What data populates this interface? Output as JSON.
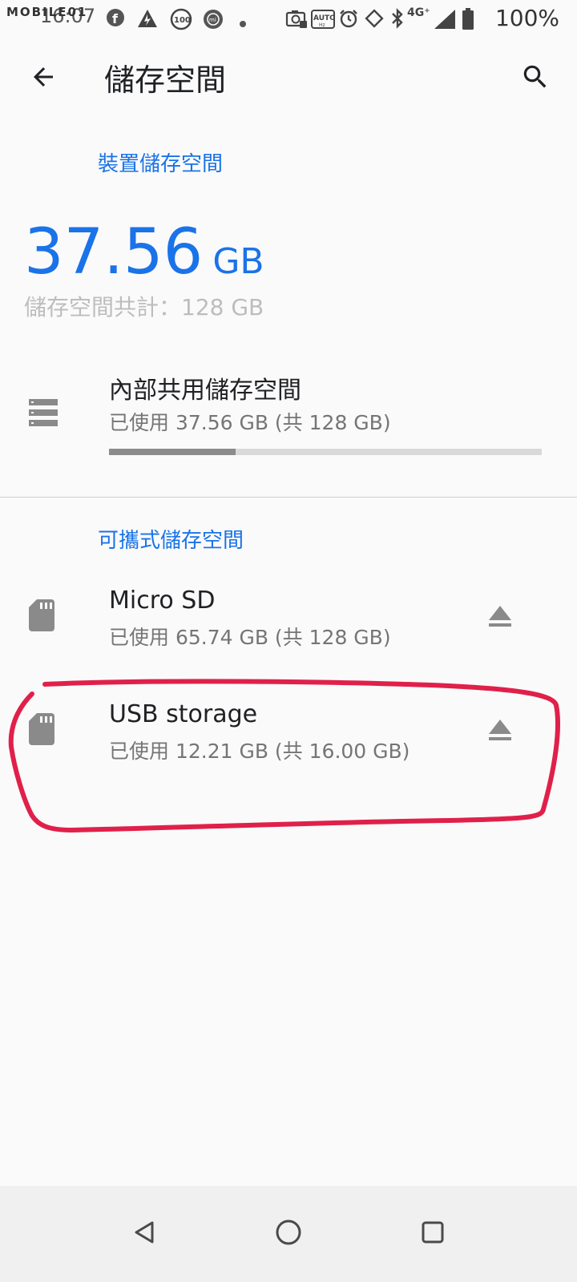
{
  "status_bar": {
    "watermark": "MOBILE01",
    "time": "16:07",
    "network": "4G⁺",
    "battery": "100%",
    "icons": [
      "facebook-icon",
      "warning-icon",
      "battery-100-icon",
      "mi-icon",
      "dot-icon",
      "camera-icon",
      "auto-icon",
      "alarm-icon",
      "rotate-icon",
      "bluetooth-icon",
      "signal-icon",
      "battery-icon"
    ]
  },
  "app_bar": {
    "title": "儲存空間",
    "back_icon": "arrow-back-icon",
    "search_icon": "search-icon"
  },
  "device_storage": {
    "header": "裝置儲存空間",
    "used_value": "37.56",
    "used_unit": "GB",
    "total_label": "儲存空間共計：128 GB",
    "internal": {
      "title": "內部共用儲存空間",
      "subtitle": "已使用 37.56 GB (共 128 GB)",
      "used_fraction": 0.293
    }
  },
  "portable_storage": {
    "header": "可攜式儲存空間",
    "items": [
      {
        "title": "Micro SD",
        "subtitle": "已使用 65.74 GB (共 128 GB)"
      },
      {
        "title": "USB storage",
        "subtitle": "已使用 12.21 GB (共 16.00 GB)"
      }
    ]
  },
  "annotation": {
    "color": "#e0204a"
  },
  "colors": {
    "accent": "#1a73e8",
    "background": "#fafafa"
  },
  "nav_bar": {
    "icons": [
      "back-triangle-icon",
      "home-circle-icon",
      "recents-square-icon"
    ]
  }
}
